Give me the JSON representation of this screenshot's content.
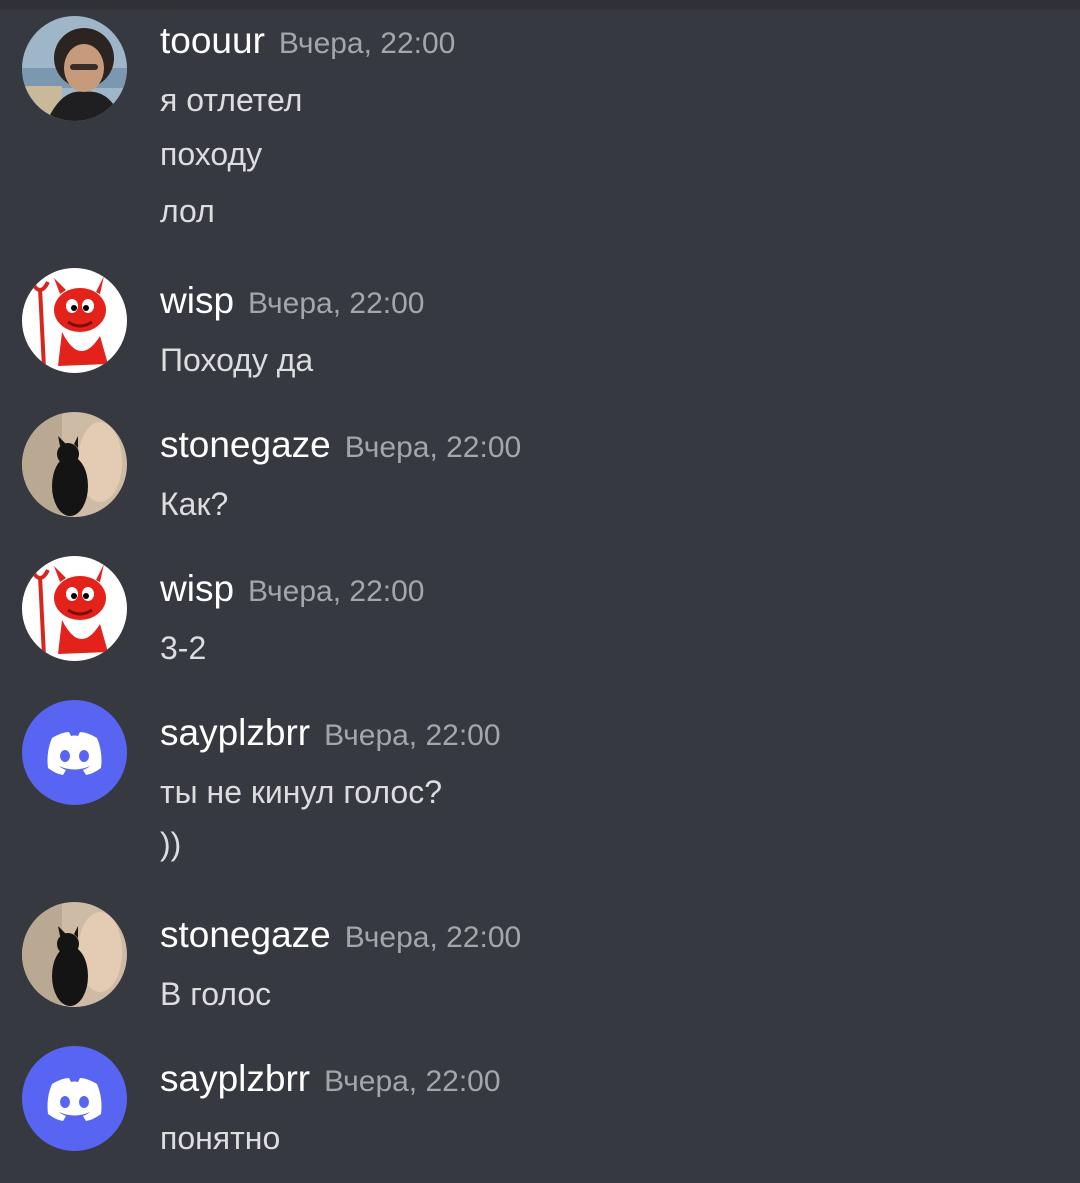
{
  "colors": {
    "background": "#36393f",
    "username": "#ffffff",
    "timestamp": "#a3a6aa",
    "message_text": "#dcddde",
    "discord_blurple": "#5865f2"
  },
  "messages": [
    {
      "author": "toouur",
      "timestamp": "Вчера, 22:00",
      "avatar": "photo-man-avatar",
      "lines": [
        "я отлетел",
        "походу",
        "лол"
      ]
    },
    {
      "author": "wisp",
      "timestamp": "Вчера, 22:00",
      "avatar": "red-devil-avatar",
      "lines": [
        "Походу да"
      ]
    },
    {
      "author": "stonegaze",
      "timestamp": "Вчера, 22:00",
      "avatar": "black-cat-photo-avatar",
      "lines": [
        "Как?"
      ]
    },
    {
      "author": "wisp",
      "timestamp": "Вчера, 22:00",
      "avatar": "red-devil-avatar",
      "lines": [
        "3-2"
      ]
    },
    {
      "author": "sayplzbrr",
      "timestamp": "Вчера, 22:00",
      "avatar": "discord-default-avatar",
      "lines": [
        "ты не кинул голос?",
        "))"
      ]
    },
    {
      "author": "stonegaze",
      "timestamp": "Вчера, 22:00",
      "avatar": "black-cat-photo-avatar",
      "lines": [
        "В голос"
      ]
    },
    {
      "author": "sayplzbrr",
      "timestamp": "Вчера, 22:00",
      "avatar": "discord-default-avatar",
      "lines": [
        "понятно"
      ]
    }
  ]
}
